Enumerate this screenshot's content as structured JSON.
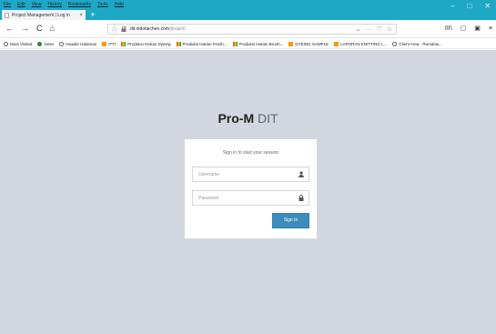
{
  "menu": [
    "File",
    "Edit",
    "View",
    "History",
    "Bookmarks",
    "Tools",
    "Help"
  ],
  "tab": {
    "title": "Project Management | Log in",
    "close": "×",
    "new": "+"
  },
  "window_controls": [
    "–",
    "□",
    "✕"
  ],
  "nav": {
    "back": "←",
    "forward": "→",
    "reload": "C",
    "home": "⌂",
    "url_domain": "dit.indotaichen.com",
    "url_path": "/project/",
    "url_right": [
      "⌄",
      "···",
      "♡",
      "☆"
    ],
    "right_buttons": [
      "III\\",
      "▢",
      "▣",
      "≡"
    ]
  },
  "bookmarks": [
    {
      "label": "Most Visited",
      "icon": "gear-icon",
      "color": "#666666"
    },
    {
      "label": "Geev",
      "icon": "globe-icon",
      "color": "#3a7d44"
    },
    {
      "label": "Header Halaman",
      "icon": "globe-icon",
      "color": "#666666"
    },
    {
      "label": "ITTI",
      "icon": "orange-icon",
      "color": "#f39c12"
    },
    {
      "label": "Produksi Harian Dyeing",
      "icon": "colorful-icon",
      "color": "#27ae60"
    },
    {
      "label": "Produksi Harian Finish...",
      "icon": "colorful-icon",
      "color": "#27ae60"
    },
    {
      "label": "Produksi Harian Brush...",
      "icon": "colorful-icon",
      "color": "#27ae60"
    },
    {
      "label": "DYEING SAMPLE",
      "icon": "orange-icon",
      "color": "#f39c12"
    },
    {
      "label": "LAPORAN KNITTING L...",
      "icon": "orange-icon",
      "color": "#f39c12"
    },
    {
      "label": "Client Area - Rumahw...",
      "icon": "globe-icon",
      "color": "#666666"
    }
  ],
  "brand": {
    "bold": "Pro-M",
    "light": " DIT"
  },
  "login": {
    "message": "Sign in to start your session",
    "username_placeholder": "Username",
    "password_placeholder": "Password",
    "signin_label": "Sign In"
  },
  "colors": {
    "titlebar": "#1fa7c6",
    "page_bg": "#d2d6de",
    "primary": "#3c8dbc"
  }
}
